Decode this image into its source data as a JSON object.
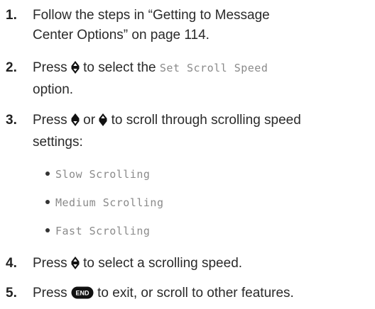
{
  "steps": [
    {
      "num": "1.",
      "line1": "Follow the steps in “Getting to Message",
      "line2": "Center Options” on page 114."
    },
    {
      "num": "2.",
      "pre": "Press",
      "lcd": "Set Scroll Speed",
      "mid": "to select the",
      "line2": "option."
    },
    {
      "num": "3.",
      "pre": "Press",
      "or": "or",
      "post": "to scroll through scrolling speed",
      "line2": "settings:"
    },
    {
      "num": "4.",
      "pre": "Press",
      "post": "to select a scrolling speed."
    },
    {
      "num": "5.",
      "pre": "Press",
      "post": "to exit, or scroll to other features."
    }
  ],
  "speed_options": [
    "Slow Scrolling",
    "Medium Scrolling",
    "Fast Scrolling"
  ],
  "icons": {
    "nav_key": "nav-key-icon",
    "nav_up": "nav-up-icon",
    "nav_down": "nav-down-icon",
    "end_key": "end-key-icon",
    "end_label": "END"
  }
}
